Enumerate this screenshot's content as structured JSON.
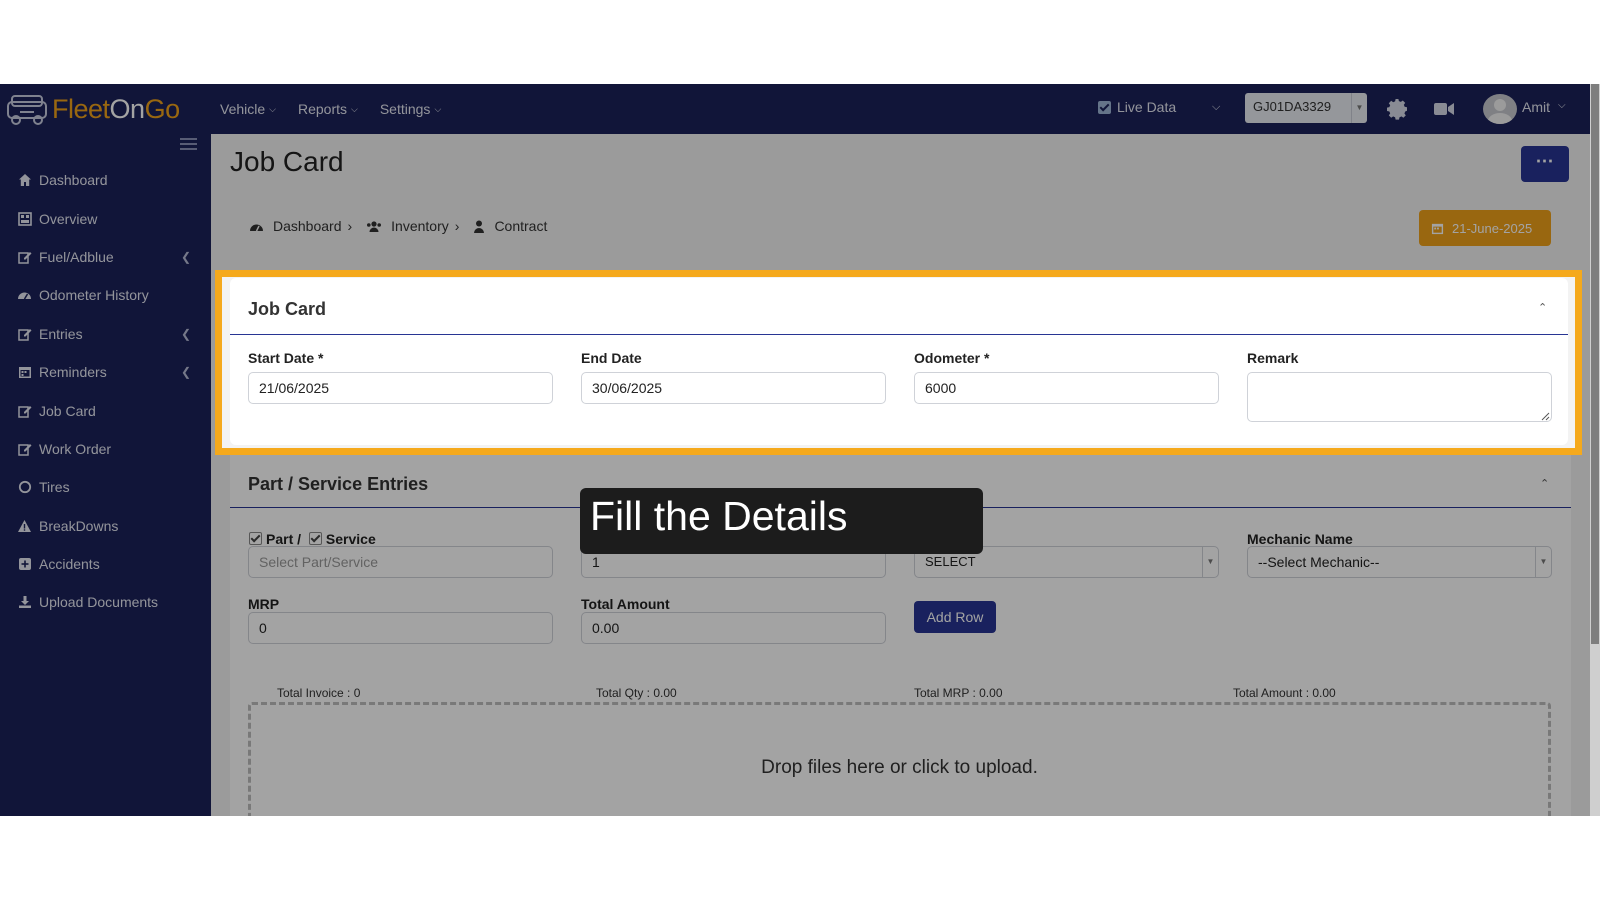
{
  "app": {
    "logo": {
      "part1": "Fleet",
      "part2": "On",
      "part3": "Go"
    },
    "nav": [
      {
        "label": "Vehicle"
      },
      {
        "label": "Reports"
      },
      {
        "label": "Settings"
      }
    ],
    "live_data_label": "Live Data",
    "vehicle_selected": "GJ01DA3329",
    "user_name": "Amit"
  },
  "sidebar": {
    "items": [
      {
        "label": "Dashboard",
        "icon": "home-icon"
      },
      {
        "label": "Overview",
        "icon": "grid-icon"
      },
      {
        "label": "Fuel/Adblue",
        "icon": "edit-icon",
        "submenu": true
      },
      {
        "label": "Odometer History",
        "icon": "speedometer-icon"
      },
      {
        "label": "Entries",
        "icon": "edit-icon",
        "submenu": true
      },
      {
        "label": "Reminders",
        "icon": "calendar-icon",
        "submenu": true
      },
      {
        "label": "Job Card",
        "icon": "edit-icon"
      },
      {
        "label": "Work Order",
        "icon": "edit-icon"
      },
      {
        "label": "Tires",
        "icon": "circle-icon"
      },
      {
        "label": "BreakDowns",
        "icon": "warning-icon"
      },
      {
        "label": "Accidents",
        "icon": "plus-square-icon"
      },
      {
        "label": "Upload Documents",
        "icon": "download-icon"
      }
    ]
  },
  "page": {
    "title": "Job Card",
    "breadcrumb": [
      "Dashboard",
      "Inventory",
      "Contract"
    ],
    "date_button": "21-June-2025"
  },
  "job_card": {
    "title": "Job Card",
    "fields": [
      {
        "label": "Start Date *",
        "value": "21/06/2025"
      },
      {
        "label": "End Date",
        "value": "30/06/2025"
      },
      {
        "label": "Odometer *",
        "value": "6000"
      },
      {
        "label": "Remark",
        "value": ""
      }
    ]
  },
  "entries": {
    "title": "Part / Service Entries",
    "part_label": "Part /",
    "service_label": "Service",
    "part_service_placeholder": "Select Part/Service",
    "qty_value": "1",
    "select_value": "SELECT",
    "mechanic_label": "Mechanic Name",
    "mechanic_value": "--Select Mechanic--",
    "mrp_label": "MRP",
    "mrp_value": "0",
    "total_amount_label": "Total Amount",
    "total_amount_value": "0.00",
    "add_row_label": "Add Row",
    "totals": [
      "Total Invoice : 0",
      "Total Qty : 0.00",
      "Total MRP : 0.00",
      "Total Amount : 0.00"
    ],
    "dropzone_text": "Drop files here or click to upload."
  },
  "tooltip": {
    "text": "Fill the Details"
  },
  "colors": {
    "navy": "#1b2159",
    "accent": "#f5a91c",
    "button": "#283593"
  }
}
